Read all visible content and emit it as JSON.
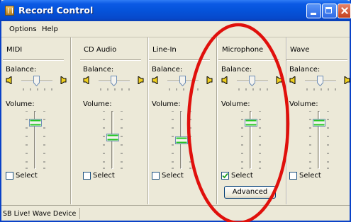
{
  "window": {
    "title": "Record Control",
    "buttons": [
      "minimize",
      "maximize",
      "close"
    ]
  },
  "menu": {
    "items": [
      "Options",
      "Help"
    ]
  },
  "channels": [
    {
      "name": "MIDI",
      "balance_label": "Balance:",
      "volume_label": "Volume:",
      "select_label": "Select",
      "selected": false,
      "balance": 0.5,
      "volume": 0.85
    },
    {
      "name": "CD Audio",
      "balance_label": "Balance:",
      "volume_label": "Volume:",
      "select_label": "Select",
      "selected": false,
      "balance": 0.5,
      "volume": 0.55
    },
    {
      "name": "Line-In",
      "balance_label": "Balance:",
      "volume_label": "Volume:",
      "select_label": "Select",
      "selected": false,
      "balance": 0.5,
      "volume": 0.5
    },
    {
      "name": "Microphone",
      "balance_label": "Balance:",
      "volume_label": "Volume:",
      "select_label": "Select",
      "selected": true,
      "balance": 0.5,
      "volume": 0.85,
      "advanced_label": "Advanced"
    },
    {
      "name": "Wave",
      "balance_label": "Balance:",
      "volume_label": "Volume:",
      "select_label": "Select",
      "selected": false,
      "balance": 0.5,
      "volume": 0.85
    }
  ],
  "status": {
    "device": "SB Live! Wave Device"
  },
  "colors": {
    "titlebar": "#0553da",
    "face": "#ece9d8",
    "annotation": "#e0100c",
    "checkmark": "#21a121"
  },
  "icons": [
    "app-icon",
    "speaker-left-icon",
    "speaker-right-icon",
    "checkbox-icon"
  ]
}
